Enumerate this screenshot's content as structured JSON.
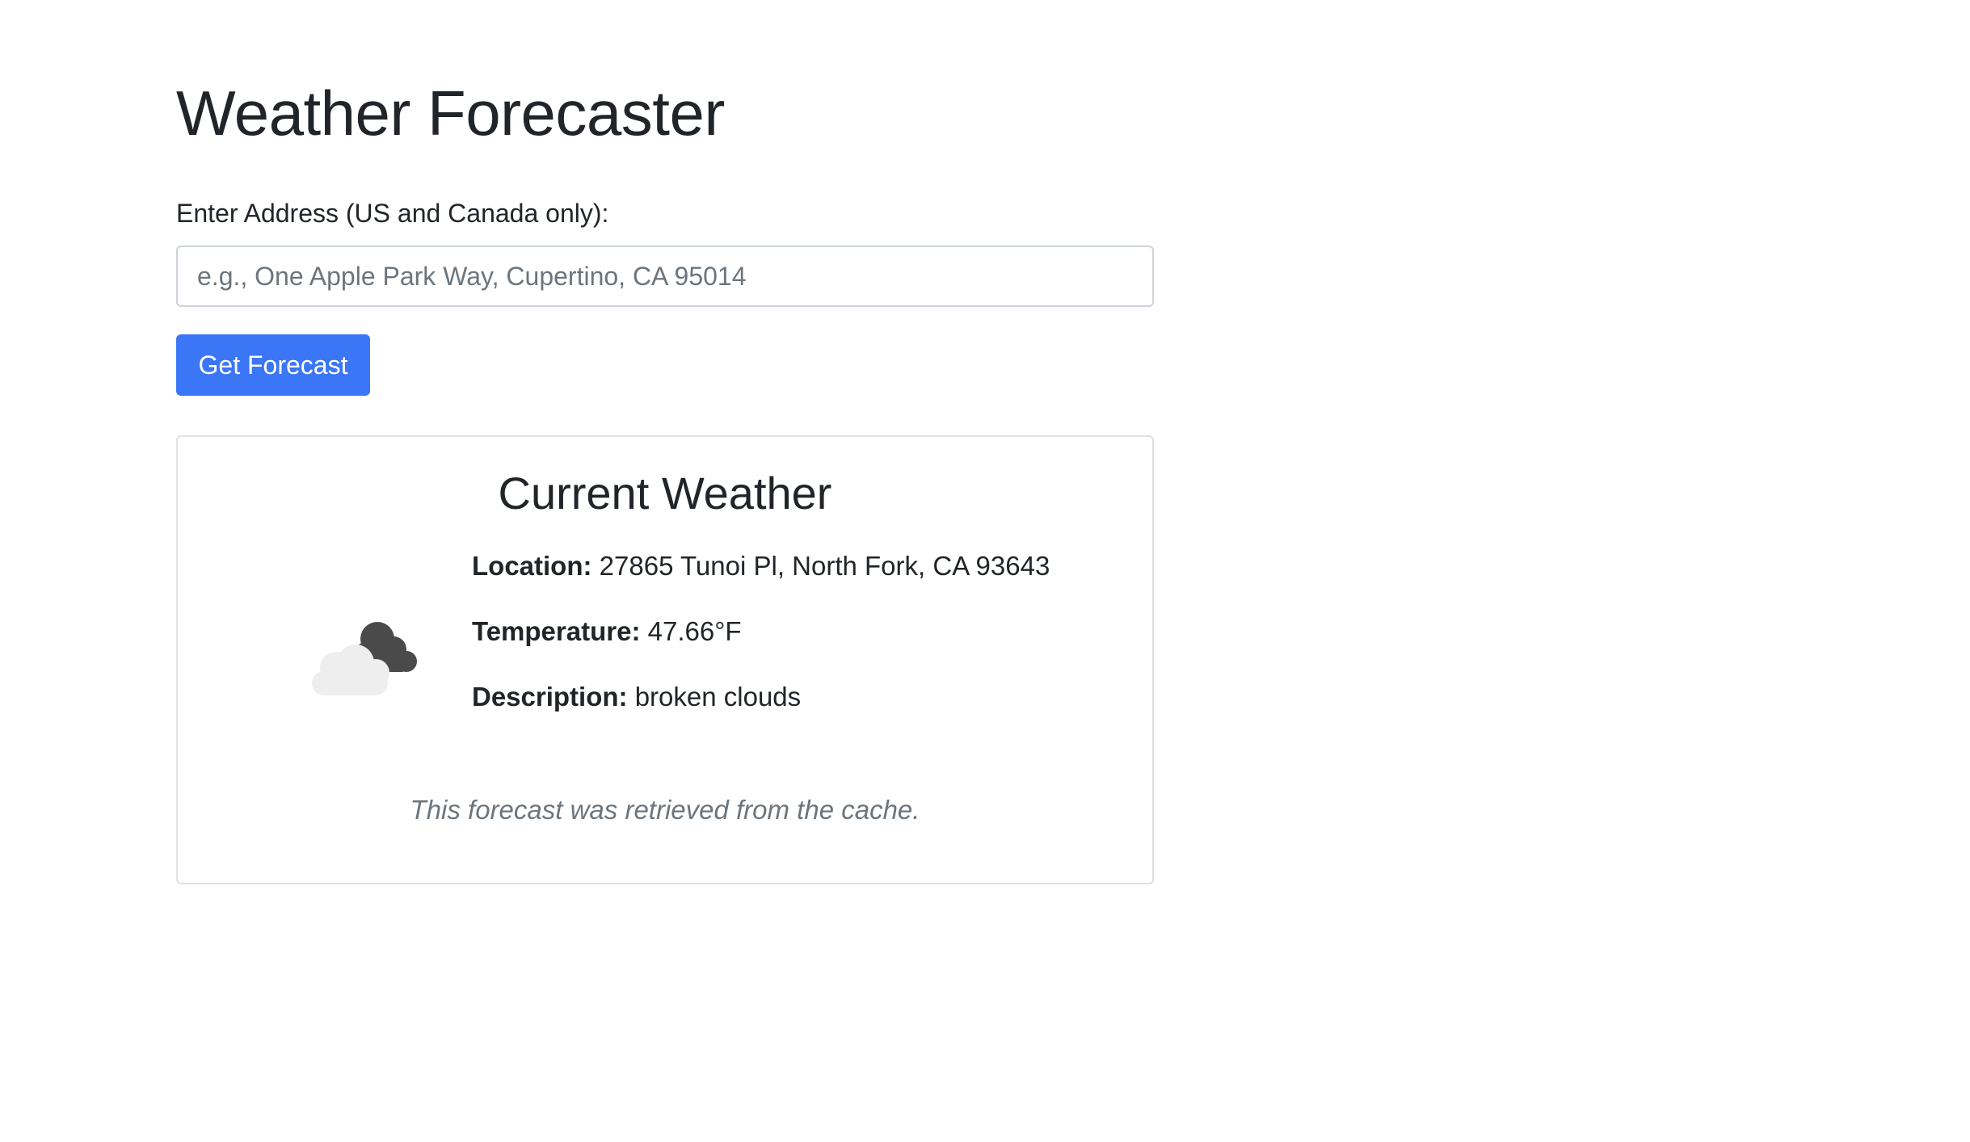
{
  "page": {
    "title": "Weather Forecaster"
  },
  "form": {
    "address_label": "Enter Address (US and Canada only):",
    "address_value": "",
    "address_placeholder": "e.g., One Apple Park Way, Cupertino, CA 95014",
    "submit_label": "Get Forecast"
  },
  "weather": {
    "heading": "Current Weather",
    "icon": "broken-clouds-icon",
    "location_label": "Location:",
    "location_value": "27865 Tunoi Pl, North Fork, CA 93643",
    "temperature_label": "Temperature:",
    "temperature_value": "47.66°F",
    "description_label": "Description:",
    "description_value": "broken clouds",
    "cache_note": "This forecast was retrieved from the cache."
  },
  "colors": {
    "primary_button": "#3b76f6",
    "text": "#212529",
    "muted_text": "#6c757d",
    "border": "#dee2e6",
    "cloud_light": "#eeeeee",
    "cloud_dark": "#4a4a4a"
  }
}
